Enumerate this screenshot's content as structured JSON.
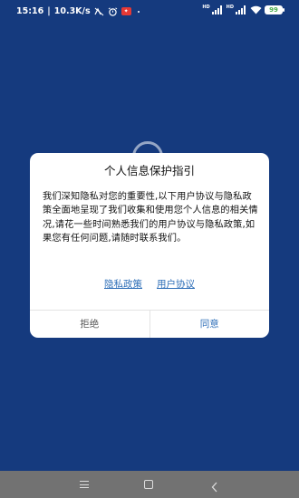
{
  "statusbar": {
    "time": "15:16",
    "network_speed": "10.3K/s",
    "separator": "|",
    "signal_1_label": "HD",
    "signal_2_label": "HD",
    "battery": "99"
  },
  "dialog": {
    "title": "个人信息保护指引",
    "body": "我们深知隐私对您的重要性,以下用户协议与隐私政策全面地呈现了我们收集和使用您个人信息的相关情况,请花一些时间熟悉我们的用户协议与隐私政策,如果您有任何问题,请随时联系我们。",
    "link_privacy": "隐私政策",
    "link_agreement": "用户协议",
    "reject_label": "拒绝",
    "agree_label": "同意"
  },
  "colors": {
    "background": "#153a7e",
    "accent": "#2f6fb8",
    "navbar": "#727272"
  },
  "navbar": {
    "icons": [
      "menu-icon",
      "home-icon",
      "back-icon"
    ]
  }
}
